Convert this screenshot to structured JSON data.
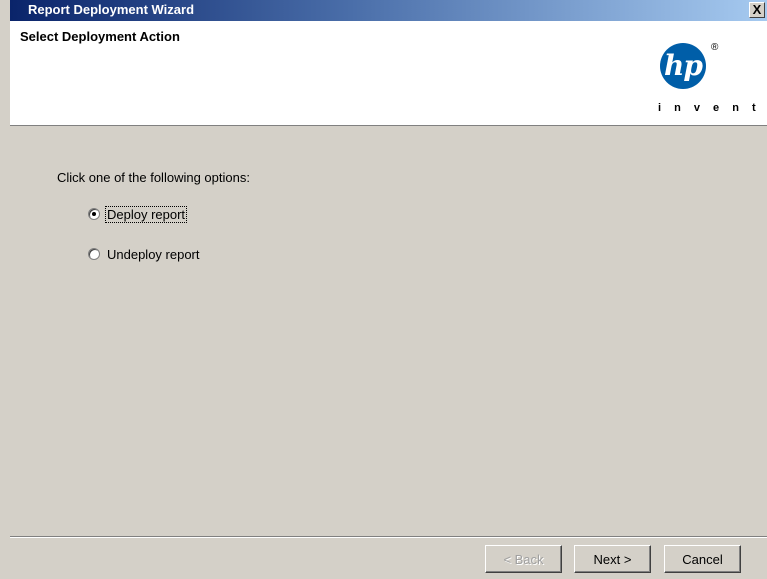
{
  "window": {
    "title": "Report Deployment Wizard",
    "close_label": "X"
  },
  "header": {
    "title": "Select Deployment Action",
    "logo": {
      "text": "hp",
      "registered_mark": "®",
      "tagline": "i n v e n t",
      "color": "#005ea8"
    }
  },
  "content": {
    "instruction": "Click one of the following options:",
    "options": [
      {
        "label": "Deploy report",
        "selected": true
      },
      {
        "label": "Undeploy report",
        "selected": false
      }
    ]
  },
  "buttons": {
    "back": {
      "label": "< Back",
      "enabled": false
    },
    "next": {
      "label": "Next >",
      "enabled": true
    },
    "cancel": {
      "label": "Cancel",
      "enabled": true
    }
  }
}
